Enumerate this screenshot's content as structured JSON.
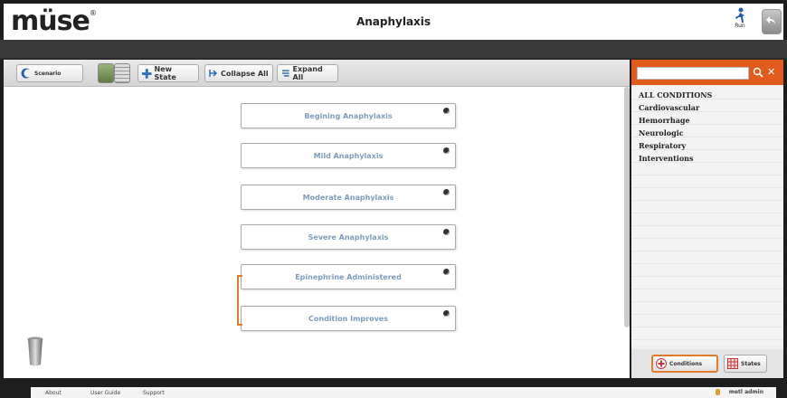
{
  "app": {
    "logo": "müse",
    "logo_mark": "®",
    "title": "Anaphylaxis",
    "run_label": "Run"
  },
  "toolbar": {
    "scenario_label": "Scenario",
    "new_state_label": "New State",
    "collapse_all_label": "Collapse All",
    "expand_all_label": "Expand All"
  },
  "states": [
    {
      "label": "Begining Anaphylaxis"
    },
    {
      "label": "Mild Anaphylaxis"
    },
    {
      "label": "Moderate Anaphylaxis"
    },
    {
      "label": "Severe Anaphylaxis"
    },
    {
      "label": "Epinephrine Administered"
    },
    {
      "label": "Condition Improves"
    }
  ],
  "sidebar": {
    "search_value": "",
    "conditions": [
      {
        "label": "ALL CONDITIONS"
      },
      {
        "label": "Cardiovascular"
      },
      {
        "label": "Hemorrhage"
      },
      {
        "label": "Neurologic"
      },
      {
        "label": "Respiratory"
      },
      {
        "label": "Interventions"
      }
    ],
    "tabs": {
      "conditions_label": "Conditions",
      "states_label": "States"
    }
  },
  "footer": {
    "about": "About",
    "user_guide": "User Guide",
    "support": "Support",
    "user": "metl admin"
  },
  "colors": {
    "accent": "#e35b1c",
    "state_text": "#7d9cc2",
    "link_line": "#e07b2a"
  }
}
